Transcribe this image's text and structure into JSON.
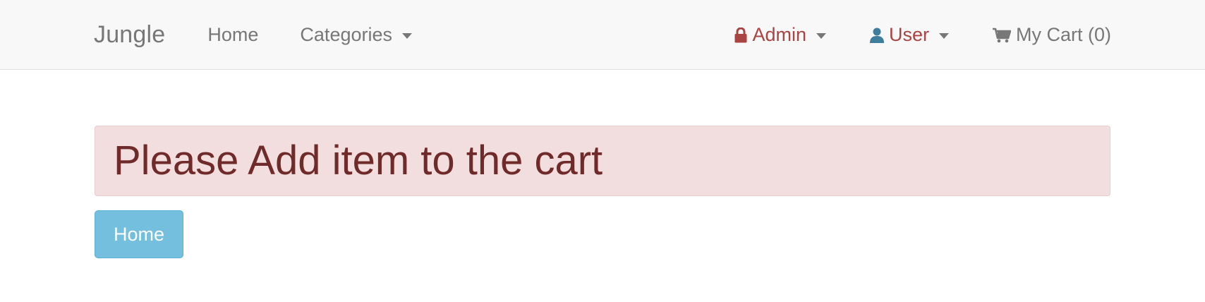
{
  "navbar": {
    "brand": "Jungle",
    "home_label": "Home",
    "categories_label": "Categories",
    "admin_label": "Admin",
    "user_label": "User",
    "cart_label": "My Cart (0)"
  },
  "alert": {
    "message": "Please Add item to the cart"
  },
  "home_button": {
    "label": "Home"
  },
  "colors": {
    "navbar_bg": "#f8f8f8",
    "nav_text": "#777777",
    "admin_accent": "#a94442",
    "user_icon": "#3e7e9c",
    "alert_bg": "#f2dede",
    "alert_text": "#702a2a",
    "button_bg": "#74bfdd"
  },
  "icons": {
    "admin": "lock-icon",
    "user": "user-icon",
    "cart": "cart-icon"
  }
}
